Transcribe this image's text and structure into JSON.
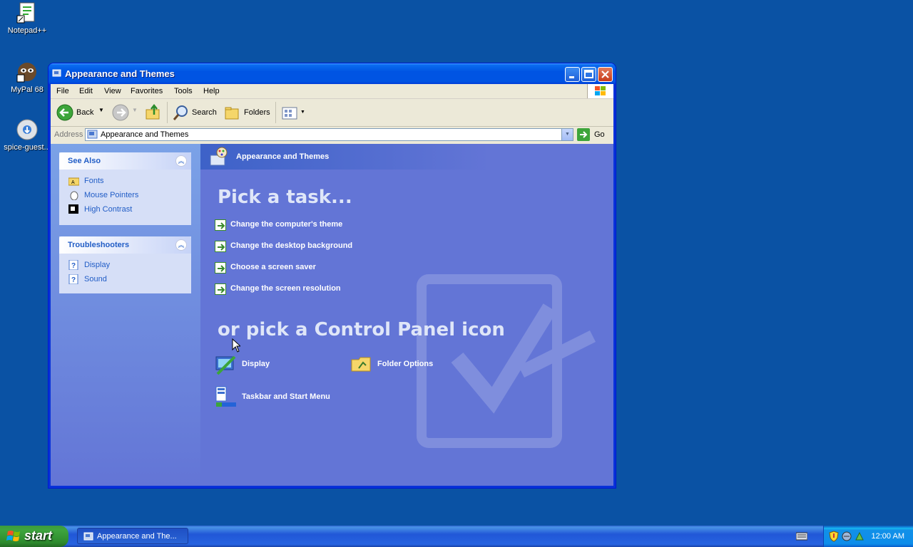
{
  "desktop": {
    "icons": [
      {
        "label": "Notepad++",
        "icon": "notepadpp-icon"
      },
      {
        "label": "MyPal 68",
        "icon": "mypal-icon"
      },
      {
        "label": "spice-guest...",
        "icon": "spice-guest-icon"
      }
    ]
  },
  "window": {
    "title": "Appearance and Themes",
    "menu": [
      "File",
      "Edit",
      "View",
      "Favorites",
      "Tools",
      "Help"
    ],
    "toolbar": {
      "back": "Back",
      "search": "Search",
      "folders": "Folders"
    },
    "address": {
      "label": "Address",
      "value": "Appearance and Themes",
      "go": "Go"
    }
  },
  "left_pane": {
    "see_also": {
      "title": "See Also",
      "items": [
        "Fonts",
        "Mouse Pointers",
        "High Contrast"
      ]
    },
    "troubleshooters": {
      "title": "Troubleshooters",
      "items": [
        "Display",
        "Sound"
      ]
    }
  },
  "main": {
    "category_title": "Appearance and Themes",
    "pick_task": "Pick a task...",
    "tasks": [
      "Change the computer's theme",
      "Change the desktop background",
      "Choose a screen saver",
      "Change the screen resolution"
    ],
    "or_pick": "or pick a Control Panel icon",
    "icons": [
      "Display",
      "Folder Options",
      "Taskbar and Start Menu"
    ]
  },
  "taskbar": {
    "start": "start",
    "task_button": "Appearance and The...",
    "clock": "12:00 AM"
  },
  "colors": {
    "desktop": "#0a52a4",
    "content_bg": "#6375d6",
    "link_blue": "#215dc6"
  }
}
